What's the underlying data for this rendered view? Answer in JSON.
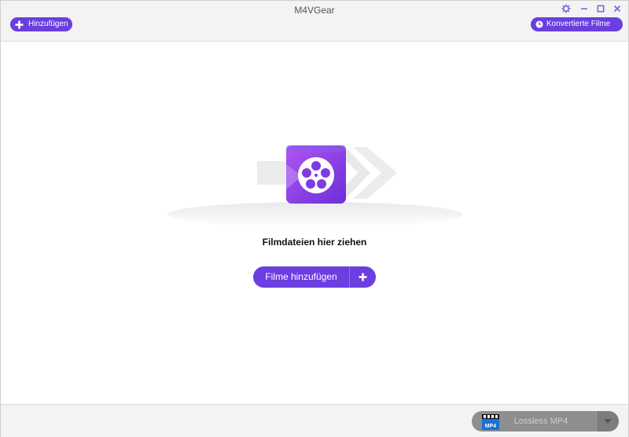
{
  "window": {
    "title": "M4VGear"
  },
  "toolbar": {
    "add_label": "Hinzufügen",
    "converted_label": "Konvertierte Filme"
  },
  "drop_area": {
    "hint": "Filmdateien hier ziehen",
    "add_files_label": "Filme hinzufügen"
  },
  "footer": {
    "format_label": "Lossless MP4",
    "format_icon_text": "MP4"
  },
  "icons": {
    "settings": "gear-icon",
    "minimize": "minimize-icon",
    "maximize": "maximize-icon",
    "close": "close-icon",
    "add": "plus-icon",
    "history": "clock-icon",
    "illustration": "film-reel-icon",
    "dropdown": "chevron-down-icon"
  },
  "colors": {
    "accent": "#6a3ee0",
    "footer_box": "#8e8e8e"
  }
}
